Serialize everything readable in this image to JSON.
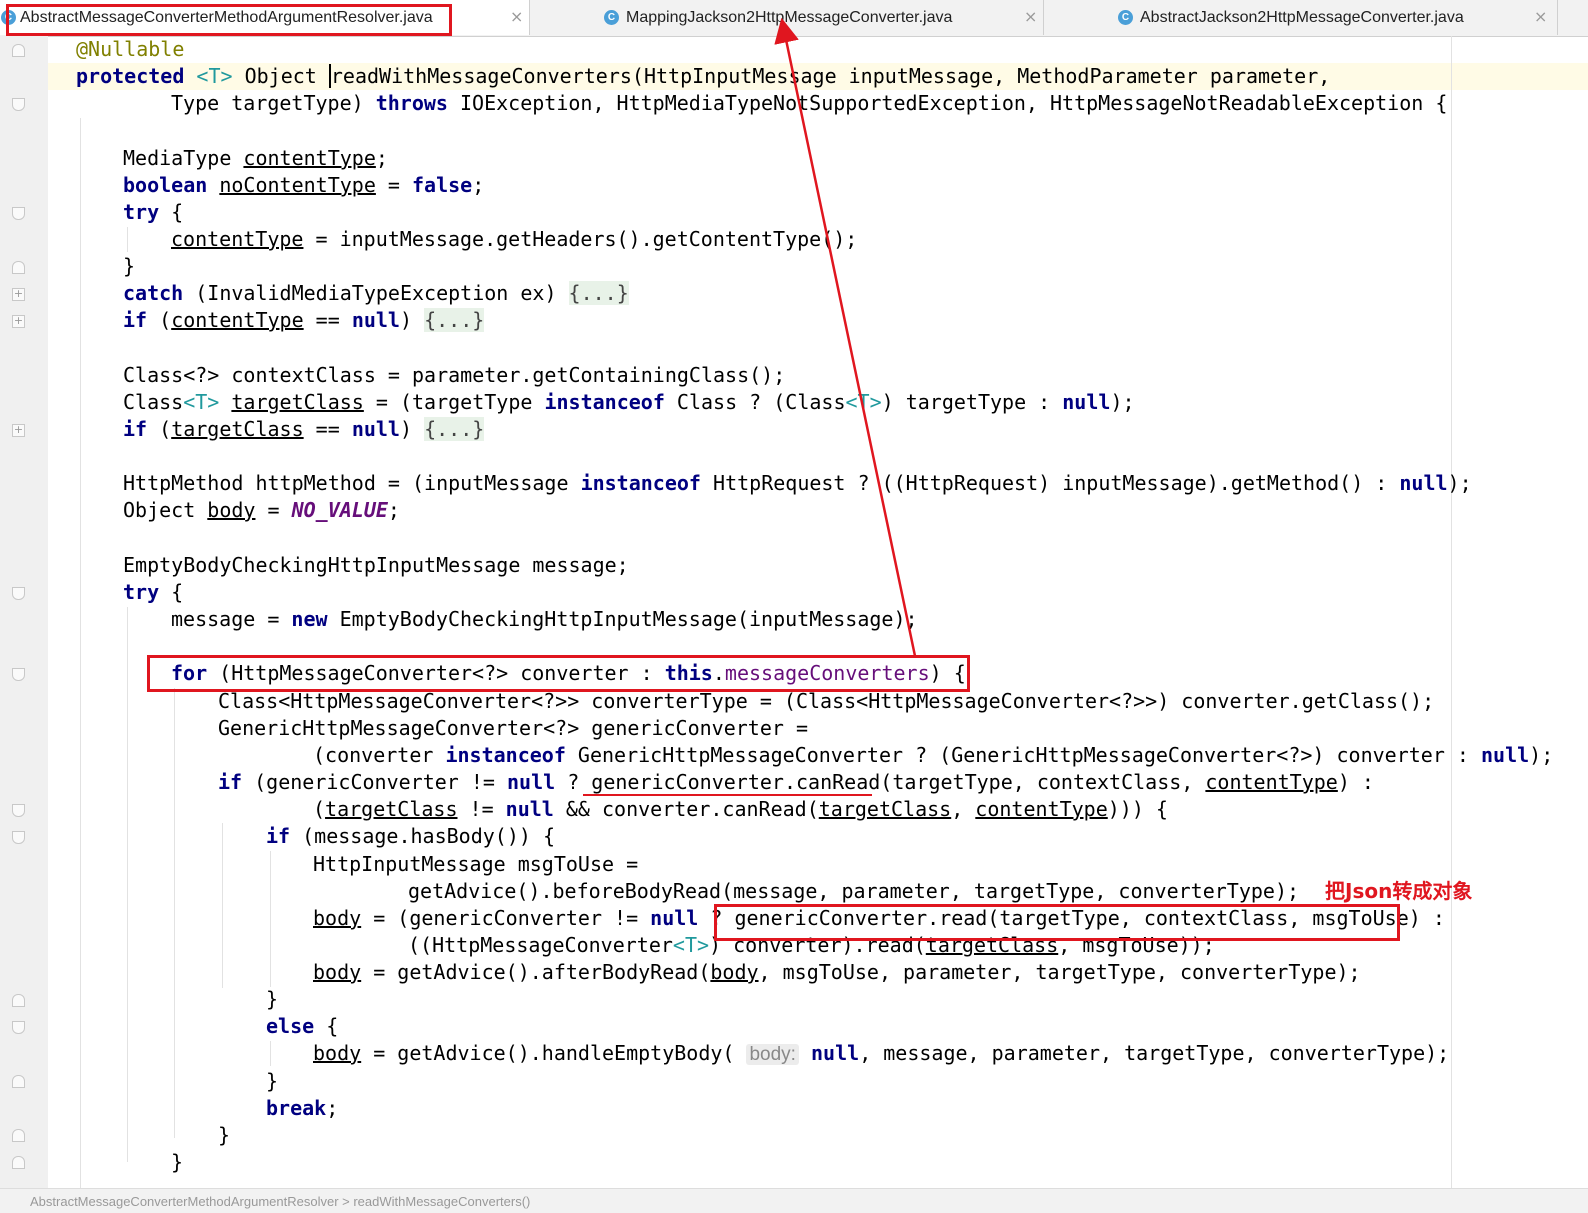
{
  "tabs": [
    {
      "label": "AbstractMessageConverterMethodArgumentResolver.java",
      "active": true
    },
    {
      "label": "MappingJackson2HttpMessageConverter.java",
      "active": false
    },
    {
      "label": "AbstractJackson2HttpMessageConverter.java",
      "active": false
    }
  ],
  "tab_icon_letter": "C",
  "close_glyph": "×",
  "annotation_label": "把Json转成对象",
  "highlight_color": "#e0161f",
  "code": {
    "l1": "@Nullable",
    "l2_kw": "protected",
    "l2_gen": "<T>",
    "l2_type": " Object ",
    "l2_method": "readWithMessageConverters",
    "l2_rest": "(HttpInputMessage inputMessage, MethodParameter parameter,",
    "l3_a": "Type targetType) ",
    "l3_kw": "throws",
    "l3_b": " IOException, HttpMediaTypeNotSupportedException, HttpMessageNotReadableException {",
    "l5_a": "MediaType ",
    "l5_var": "contentType",
    "l6_kw": "boolean",
    "l6_var": "noContentType",
    "l6_b": " = ",
    "l6_kw2": "false",
    "try": "try",
    "l8_var": "contentType",
    "l8_b": " = inputMessage.getHeaders().getContentType();",
    "brace_close": "}",
    "l10_kw": "catch",
    "l10_b": " (InvalidMediaTypeException ex) ",
    "folded": "{...}",
    "if": "if",
    "l11_var": "contentType",
    "l11_b": " == ",
    "null": "null",
    "l13": "Class<?> contextClass = parameter.getContainingClass();",
    "l14_a": "Class",
    "l14_var": "targetClass",
    "l14_b": " = (targetType ",
    "instanceof": "instanceof",
    "l14_c": " Class ? (Class",
    "l14_d": ") targetType : ",
    "l15_var": "targetClass",
    "l17_a": "HttpMethod httpMethod = (inputMessage ",
    "l17_b": " HttpRequest ? ((HttpRequest) inputMessage).getMethod() : ",
    "l18_a": "Object ",
    "l18_var": "body",
    "l18_const": "NO_VALUE",
    "l20": "EmptyBodyCheckingHttpInputMessage message;",
    "l22_a": "message = ",
    "new": "new",
    "l22_b": " EmptyBodyCheckingHttpInputMessage(inputMessage);",
    "for": "for",
    "l24_a": " (HttpMessageConverter<?> converter : ",
    "this": "this",
    "l24_fld": "messageConverters",
    "l24_b": ") {",
    "l25": "Class<HttpMessageConverter<?>> converterType = (Class<HttpMessageConverter<?>>) converter.getClass();",
    "l26": "GenericHttpMessageConverter<?> genericConverter =",
    "l27_a": "(converter ",
    "l27_b": " GenericHttpMessageConverter ? (GenericHttpMessageConverter<?>) converter : ",
    "l28_a": " (genericConverter != ",
    "l28_b": " ? ",
    "l28_c": "genericConverter.canRead",
    "l28_d": "(targetType, contextClass, ",
    "l28_var": "contentType",
    "l28_e": ") :",
    "l29_a": "(",
    "l29_var": "targetClass",
    "l29_b": " != ",
    "l29_c": " && converter.canRead(",
    "l29_d": ", ",
    "l29_e": "))) {",
    "l30_b": " (message.hasBody()) {",
    "l31": "HttpInputMessage msgToUse =",
    "l32": "getAdvice().beforeBodyRead(message, parameter, targetType, converterType);",
    "l33_var": "body",
    "l33_a": " = (genericConverter != ",
    "l33_b": " ? ",
    "l33_c": "genericConverter.read(targetType, contextClass, msgToUse)",
    "l33_d": " :",
    "l34_a": "((HttpMessageConverter",
    "l34_b": ") converter).read(",
    "l34_var": "targetClass",
    "l34_c": ", msgToUse));",
    "l35_var": "body",
    "l35_a": " = getAdvice().afterBodyRead(",
    "l35_b": ", msgToUse, parameter, targetType, converterType);",
    "else": "else",
    "l38_var": "body",
    "l38_a": " = getAdvice().handleEmptyBody( ",
    "l38_hint": "body:",
    "l38_b": ", message, parameter, targetType, converterType);",
    "break": "break",
    "semicolon": ";",
    "brace_open": " {"
  },
  "status_text": "AbstractMessageConverterMethodArgumentResolver  >  readWithMessageConverters()"
}
